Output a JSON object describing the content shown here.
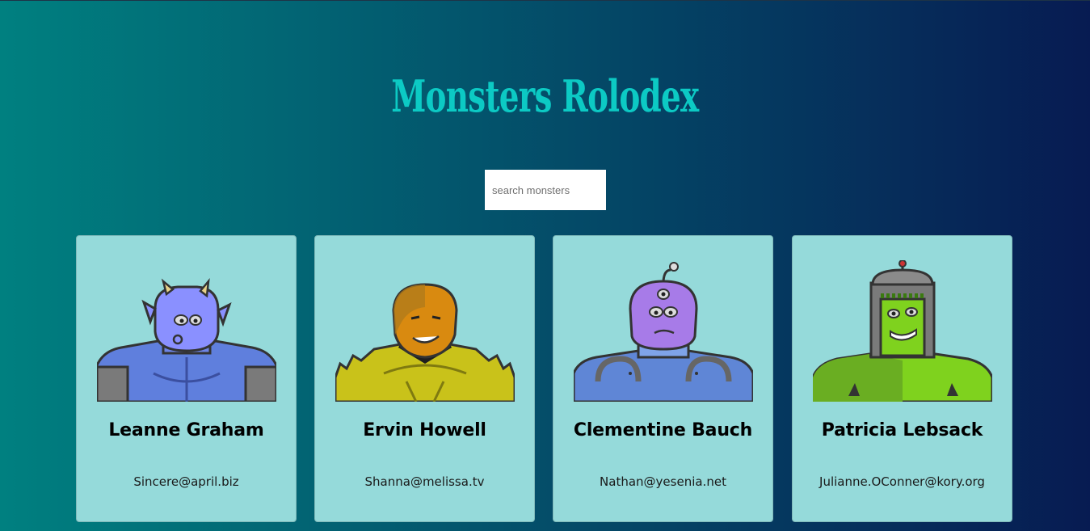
{
  "app": {
    "title": "Monsters Rolodex",
    "title_color": "#0ccac4",
    "background_gradient": [
      "#008080",
      "#071b52"
    ]
  },
  "search": {
    "placeholder": "search monsters",
    "value": ""
  },
  "cards": [
    {
      "name": "Leanne Graham",
      "email": "Sincere@april.biz",
      "avatar_icon": "blue-horned-monster-icon",
      "primary_color": "#7b8cf5"
    },
    {
      "name": "Ervin Howell",
      "email": "Shanna@melissa.tv",
      "avatar_icon": "orange-spiky-monster-icon",
      "primary_color": "#d98a10"
    },
    {
      "name": "Clementine Bauch",
      "email": "Nathan@yesenia.net",
      "avatar_icon": "purple-cyclops-monster-icon",
      "primary_color": "#a77be8"
    },
    {
      "name": "Patricia Lebsack",
      "email": "Julianne.OConner@kory.org",
      "avatar_icon": "green-robot-monster-icon",
      "primary_color": "#7fd21e"
    }
  ],
  "card_background": "#95dada"
}
